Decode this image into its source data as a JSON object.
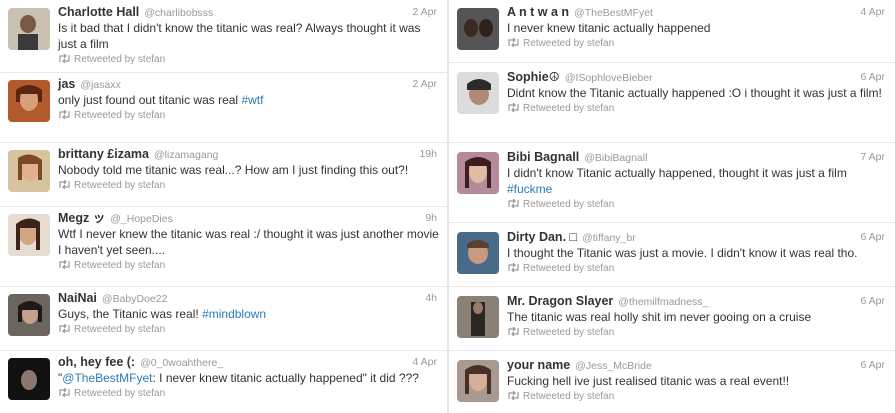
{
  "left_column": [
    {
      "name": "Charlotte Hall",
      "handle": "@charlibobsss",
      "time": "2 Apr",
      "text": "Is it bad that I didn't know the titanic was real? Always thought it was just a film",
      "link": "",
      "text_after": "",
      "retweeted": "Retweeted by stefan"
    },
    {
      "name": "jas",
      "handle": "@jasaxx",
      "time": "2 Apr",
      "text": "only just found out titanic was real ",
      "link": "#wtf",
      "text_after": "",
      "retweeted": "Retweeted by stefan"
    },
    {
      "name": "brittany £izama",
      "handle": "@lizamagang",
      "time": "19h",
      "text": "Nobody told me titanic was real...? How am I just finding this out?!",
      "link": "",
      "text_after": "",
      "retweeted": "Retweeted by stefan"
    },
    {
      "name": "Megz ッ",
      "handle": "@_HopeDies",
      "time": "9h",
      "text": "Wtf I never knew the titanic was real :/ thought it was just another movie I haven't yet seen....",
      "link": "",
      "text_after": "",
      "retweeted": "Retweeted by stefan"
    },
    {
      "name": "NaiNai",
      "handle": "@BabyDoe22",
      "time": "4h",
      "text": "Guys, the Titanic was real! ",
      "link": "#mindblown",
      "text_after": "",
      "retweeted": "Retweeted by stefan"
    },
    {
      "name": "oh, hey fee (:",
      "handle": "@0_0woahthere_",
      "time": "4 Apr",
      "text": "\"",
      "link": "@TheBestMFyet",
      "text_after": ": I never knew titanic actually happened\" it did ???",
      "retweeted": "Retweeted by stefan"
    }
  ],
  "right_column": [
    {
      "name": "A n t w a n",
      "handle": "@TheBestMFyet",
      "time": "4 Apr",
      "text": "I never knew titanic actually happened",
      "link": "",
      "text_after": "",
      "retweeted": "Retweeted by stefan"
    },
    {
      "name": "Sophie☮",
      "handle": "@ISophloveBieber",
      "time": "6 Apr",
      "text": "Didnt know the Titanic actually happened :O i thought it was just a film!",
      "link": "",
      "text_after": "",
      "retweeted": "Retweeted by stefan"
    },
    {
      "name": "Bibi Bagnall",
      "handle": "@BibiBagnall",
      "time": "7 Apr",
      "text": "I didn't know Titanic actually happened, thought it was just a film ",
      "link": "#fuckme",
      "text_after": "",
      "retweeted": "Retweeted by stefan"
    },
    {
      "name": "Dirty Dan. □",
      "handle": "@tiffany_br",
      "time": "6 Apr",
      "text": "I thought the Titanic was just a movie. I didn't know it was real tho.",
      "link": "",
      "text_after": "",
      "retweeted": "Retweeted by stefan"
    },
    {
      "name": "Mr. Dragon Slayer",
      "handle": "@themilfmadness_",
      "time": "6 Apr",
      "text": "The titanic was real holly shit im never gooing on a cruise",
      "link": "",
      "text_after": "",
      "retweeted": "Retweeted by stefan"
    },
    {
      "name": "your name",
      "handle": "@Jess_McBride",
      "time": "6 Apr",
      "text": "Fucking hell ive just realised titanic was a real event!!",
      "link": "",
      "text_after": "",
      "retweeted": "Retweeted by stefan"
    }
  ]
}
